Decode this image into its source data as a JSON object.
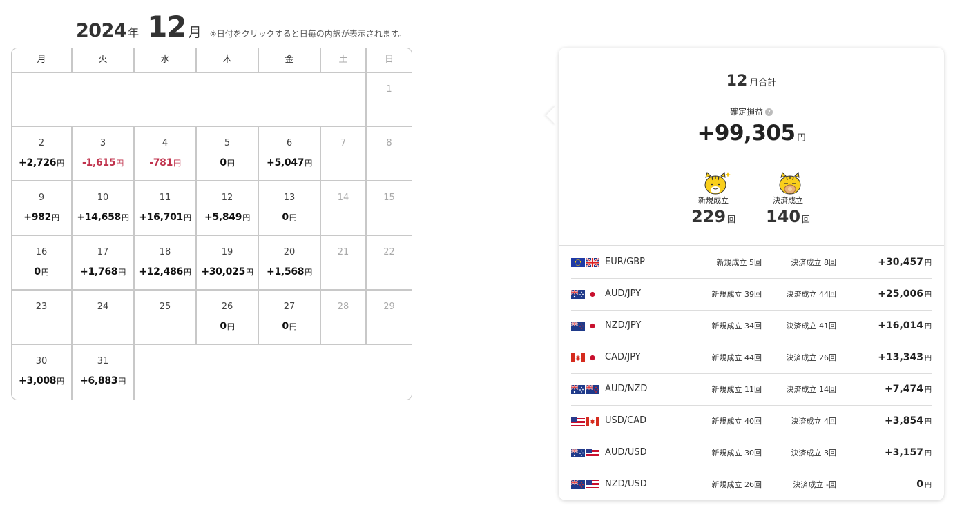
{
  "header": {
    "year": "2024",
    "year_suffix": "年",
    "month": "12",
    "month_suffix": "月",
    "note": "※日付をクリックすると日毎の内訳が表示されます。"
  },
  "weekdays": [
    "月",
    "火",
    "水",
    "木",
    "金",
    "土",
    "日"
  ],
  "yen": "円",
  "calendar": {
    "weeks": [
      [
        {
          "d": "",
          "v": ""
        },
        {
          "d": "",
          "v": ""
        },
        {
          "d": "",
          "v": ""
        },
        {
          "d": "",
          "v": ""
        },
        {
          "d": "",
          "v": ""
        },
        {
          "d": "",
          "v": ""
        },
        {
          "d": "1",
          "v": ""
        }
      ],
      [
        {
          "d": "2",
          "v": "+2,726"
        },
        {
          "d": "3",
          "v": "-1,615"
        },
        {
          "d": "4",
          "v": "-781"
        },
        {
          "d": "5",
          "v": "0"
        },
        {
          "d": "6",
          "v": "+5,047"
        },
        {
          "d": "7",
          "v": ""
        },
        {
          "d": "8",
          "v": ""
        }
      ],
      [
        {
          "d": "9",
          "v": "+982"
        },
        {
          "d": "10",
          "v": "+14,658"
        },
        {
          "d": "11",
          "v": "+16,701"
        },
        {
          "d": "12",
          "v": "+5,849"
        },
        {
          "d": "13",
          "v": "0"
        },
        {
          "d": "14",
          "v": ""
        },
        {
          "d": "15",
          "v": ""
        }
      ],
      [
        {
          "d": "16",
          "v": "0"
        },
        {
          "d": "17",
          "v": "+1,768"
        },
        {
          "d": "18",
          "v": "+12,486"
        },
        {
          "d": "19",
          "v": "+30,025"
        },
        {
          "d": "20",
          "v": "+1,568"
        },
        {
          "d": "21",
          "v": ""
        },
        {
          "d": "22",
          "v": ""
        }
      ],
      [
        {
          "d": "23",
          "v": ""
        },
        {
          "d": "24",
          "v": ""
        },
        {
          "d": "25",
          "v": ""
        },
        {
          "d": "26",
          "v": "0"
        },
        {
          "d": "27",
          "v": "0"
        },
        {
          "d": "28",
          "v": ""
        },
        {
          "d": "29",
          "v": ""
        }
      ],
      [
        {
          "d": "30",
          "v": "+3,008"
        },
        {
          "d": "31",
          "v": "+6,883"
        },
        {
          "d": "",
          "v": ""
        },
        {
          "d": "",
          "v": ""
        },
        {
          "d": "",
          "v": ""
        },
        {
          "d": "",
          "v": ""
        },
        {
          "d": "",
          "v": ""
        }
      ]
    ]
  },
  "summary": {
    "month": "12",
    "title_suffix": "月合計",
    "label": "確定損益",
    "help_icon": "question-icon",
    "total": "+99,305",
    "total_unit": "円",
    "new_label": "新規成立",
    "new_count": "229",
    "settle_label": "決済成立",
    "settle_count": "140",
    "count_unit": "回",
    "colors": {
      "negative": "#c0334d",
      "mascot": "#f9cf1c"
    }
  },
  "pairs": [
    {
      "name": "EUR/GBP",
      "flags": [
        "eu",
        "gb"
      ],
      "new": "新規成立 5回",
      "settle": "決済成立 8回",
      "pl": "+30,457"
    },
    {
      "name": "AUD/JPY",
      "flags": [
        "au",
        "jp"
      ],
      "new": "新規成立 39回",
      "settle": "決済成立 44回",
      "pl": "+25,006"
    },
    {
      "name": "NZD/JPY",
      "flags": [
        "nz",
        "jp"
      ],
      "new": "新規成立 34回",
      "settle": "決済成立 41回",
      "pl": "+16,014"
    },
    {
      "name": "CAD/JPY",
      "flags": [
        "ca",
        "jp"
      ],
      "new": "新規成立 44回",
      "settle": "決済成立 26回",
      "pl": "+13,343"
    },
    {
      "name": "AUD/NZD",
      "flags": [
        "au",
        "nz"
      ],
      "new": "新規成立 11回",
      "settle": "決済成立 14回",
      "pl": "+7,474"
    },
    {
      "name": "USD/CAD",
      "flags": [
        "us",
        "ca"
      ],
      "new": "新規成立 40回",
      "settle": "決済成立 4回",
      "pl": "+3,854"
    },
    {
      "name": "AUD/USD",
      "flags": [
        "au",
        "us"
      ],
      "new": "新規成立 30回",
      "settle": "決済成立 3回",
      "pl": "+3,157"
    },
    {
      "name": "NZD/USD",
      "flags": [
        "nz",
        "us"
      ],
      "new": "新規成立 26回",
      "settle": "決済成立 -回",
      "pl": "0"
    }
  ]
}
